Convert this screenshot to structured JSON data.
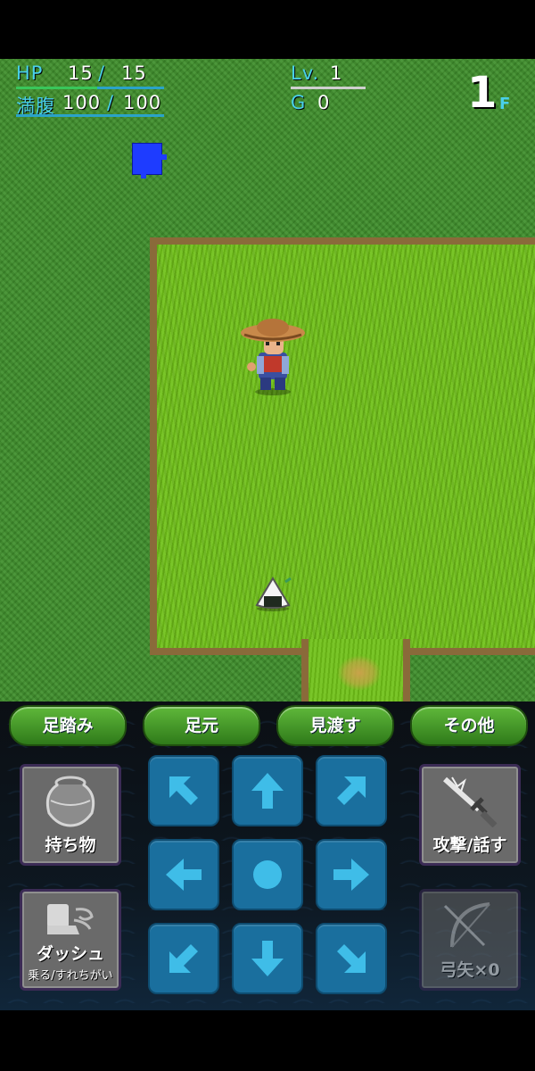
{
  "hud": {
    "hp_label": "HP",
    "hp_current": "15",
    "hp_separator": "/",
    "hp_max": "15",
    "hp_fraction": 1.0,
    "fullness_label": "満腹",
    "fullness_current": "100",
    "fullness_separator": "/",
    "fullness_max": "100",
    "level_label": "Lv.",
    "level_value": "1",
    "gold_label": "G",
    "gold_value": "0",
    "floor_number": "1",
    "floor_unit": "F"
  },
  "action_bar": {
    "stomp": "足踏み",
    "underfoot": "足元",
    "look_around": "見渡す",
    "other": "その他"
  },
  "side_buttons": {
    "inventory": "持ち物",
    "attack_talk": "攻撃/話す",
    "dash": "ダッシュ",
    "dash_sub": "乗る/すれちがい",
    "arrows": "弓矢×0"
  },
  "icons": {
    "dpad": [
      "arrow-up-left-icon",
      "arrow-up-icon",
      "arrow-up-right-icon",
      "arrow-left-icon",
      "circle-wait-icon",
      "arrow-right-icon",
      "arrow-down-left-icon",
      "arrow-down-icon",
      "arrow-down-right-icon"
    ],
    "inventory": "pot-icon",
    "attack": "sword-icon",
    "dash": "boot-wind-icon",
    "arrows": "bow-icon"
  },
  "colors": {
    "hud_cyan": "#49d0ea",
    "dpad_blue": "#1a6f9e",
    "pill_green": "#4fa52e",
    "grass_light": "#72c21c",
    "grass_dark": "#3f8f2c"
  }
}
